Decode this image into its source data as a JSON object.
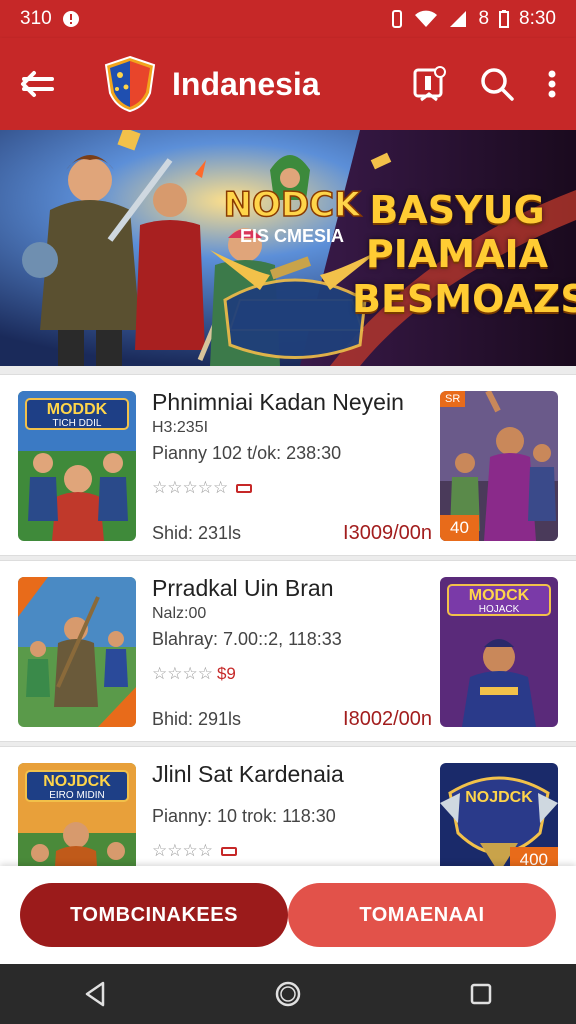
{
  "status_bar": {
    "time_left": "310",
    "clock": "8:30",
    "battery": "8"
  },
  "app_bar": {
    "title": "Indanesia",
    "icons": [
      "back-arrow-icon",
      "shield-logo-icon",
      "bookmark-icon",
      "search-icon",
      "more-vert-icon"
    ]
  },
  "banner": {
    "logo_line1": "NODCK",
    "logo_line2": "EIS CMESIA",
    "heading": [
      "BASYUG",
      "PIAMAIA",
      "BESMOAZSA"
    ]
  },
  "cards": [
    {
      "title": "Phnimniai Kadan Neyein",
      "line1": "H3:235I",
      "line2": "Pіanny 102 t/ok: 238:30",
      "rating_extra": "",
      "shid": "Shid: 231ls",
      "price": "I3009/00n",
      "left_thumb_text": "MODDK",
      "left_thumb_sub": "TICH DDIL",
      "right_badge": "40",
      "right_corner": "SR"
    },
    {
      "title": "Prradkal Uin Bran",
      "line1": "Nalz:00",
      "line2": "Blahray: 7.00::2, 118:33",
      "rating_extra": "$9",
      "shid": "Bhid: 291ls",
      "price": "I8002/00n",
      "right_thumb_text": "MODCK",
      "right_thumb_sub": "HOJACK"
    },
    {
      "title": "Jlinl Sat Kardenaia",
      "line2": "Pіanny: 10 trok: 118:30",
      "left_thumb_text": "NOJDCK",
      "left_thumb_sub": "EIRO MIDIN",
      "right_thumb_text": "NOJDCK",
      "right_badge": "400"
    }
  ],
  "actions": {
    "primary": "TOMBCINAKEES",
    "secondary": "TOMAENAAI"
  },
  "colors": {
    "brand_red": "#c62828",
    "dark_red": "#9b1b1b",
    "accent_red": "#e2524a",
    "gold": "#ffcc33"
  },
  "nav": {
    "icons": [
      "back-triangle-icon",
      "home-circle-icon",
      "recents-square-icon"
    ]
  }
}
